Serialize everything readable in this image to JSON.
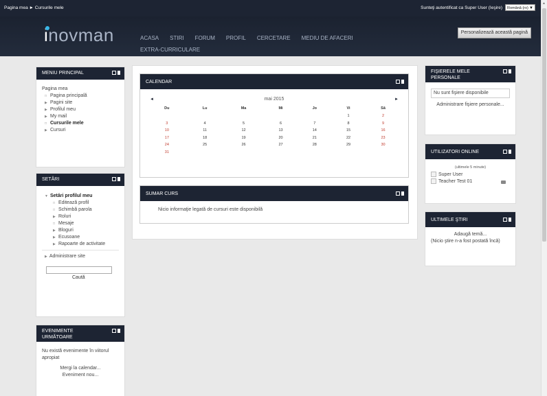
{
  "topbar": {
    "breadcrumb": [
      "Pagina mea",
      "Cursurile mele"
    ],
    "breadcrumb_sep": "►",
    "login_text": "Sunteţi autentificat ca Super User (Ieşire)",
    "language": "Română (ro)"
  },
  "header": {
    "logo": "inovman",
    "nav": [
      "ACASA",
      "STIRI",
      "FORUM",
      "PROFIL",
      "CERCETARE",
      "MEDIU DE AFACERI",
      "EXTRA-CURRICULARE"
    ],
    "customize_label": "Personalizează această pagină"
  },
  "main_menu": {
    "title": "MENIU PRINCIPAL",
    "root": "Pagina mea",
    "items": [
      {
        "label": "Pagina principală",
        "marker": "□",
        "bold": false
      },
      {
        "label": "Pagini site",
        "marker": "▶",
        "bold": false
      },
      {
        "label": "Profilul meu",
        "marker": "▶",
        "bold": false
      },
      {
        "label": "My mail",
        "marker": "▶",
        "bold": false
      },
      {
        "label": "Cursurile mele",
        "marker": "□",
        "bold": true
      },
      {
        "label": "Cursuri",
        "marker": "▶",
        "bold": false
      }
    ]
  },
  "settings": {
    "title": "SETĂRI",
    "profile_settings": "Setări profilul meu",
    "items": [
      {
        "label": "Editează profil",
        "marker": "□"
      },
      {
        "label": "Schimbă parola",
        "marker": "□"
      },
      {
        "label": "Roluri",
        "marker": "▶"
      },
      {
        "label": "Mesaje",
        "marker": "□"
      },
      {
        "label": "Bloguri",
        "marker": "▶"
      },
      {
        "label": "Ecusoane",
        "marker": "▶"
      },
      {
        "label": "Rapoarte de activitate",
        "marker": "▶"
      }
    ],
    "site_admin": "Administrare site",
    "search_button": "Caută"
  },
  "upcoming": {
    "title_line1": "EVENIMENTE",
    "title_line2": "URMĂTOARE",
    "no_events": "Nu există evenimente în viitorul apropiat",
    "goto_calendar": "Mergi la calendar...",
    "new_event": "Eveniment nou..."
  },
  "calendar": {
    "title": "CALENDAR",
    "month": "mai 2015",
    "prev": "◄",
    "next": "►",
    "weekdays": [
      "Du",
      "Lu",
      "Ma",
      "Mi",
      "Jo",
      "Vi",
      "Sâ"
    ],
    "weeks": [
      [
        "",
        "",
        "",
        "",
        "",
        "1",
        "2"
      ],
      [
        "3",
        "4",
        "5",
        "6",
        "7",
        "8",
        "9"
      ],
      [
        "10",
        "11",
        "12",
        "13",
        "14",
        "15",
        "16"
      ],
      [
        "17",
        "18",
        "19",
        "20",
        "21",
        "22",
        "23"
      ],
      [
        "24",
        "25",
        "26",
        "27",
        "28",
        "29",
        "30"
      ],
      [
        "31",
        "",
        "",
        "",
        "",
        "",
        ""
      ]
    ]
  },
  "course_summary": {
    "title": "SUMAR CURS",
    "text": "Nicio informaţie legată de cursuri este disponibilă"
  },
  "private_files": {
    "title_line1": "FIŞIERELE MELE",
    "title_line2": "PERSONALE",
    "no_files": "Nu sunt fişiere disponibile",
    "manage": "Administrare fişiere personale..."
  },
  "online_users": {
    "title": "UTILIZATORI ONLINE",
    "period": "(ultimele 5 minute)",
    "users": [
      "Super User",
      "Teacher Test 01"
    ]
  },
  "news": {
    "title": "ULTIMELE ŞTIRI",
    "add_topic": "Adaugă temă...",
    "none": "(Nicio ştire n-a fost postată încă)"
  },
  "colors": {
    "header_bg": "#1d2433",
    "weekend": "#c0392b",
    "logo_dot": "#38b7e8"
  }
}
